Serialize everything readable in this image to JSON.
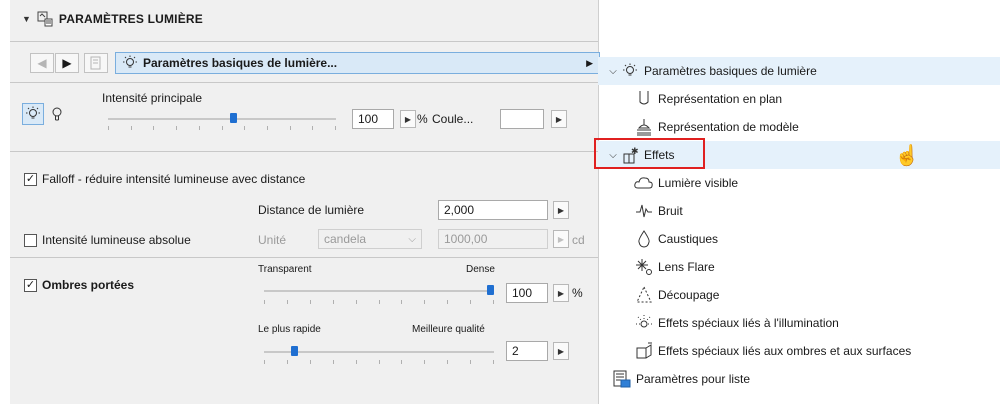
{
  "panel": {
    "title": "PARAMÈTRES LUMIÈRE",
    "preset": "Paramètres basiques de lumière...",
    "main_intensity_label": "Intensité principale",
    "main_intensity_value": "100",
    "main_intensity_level": 0.55,
    "percent_unit": "%",
    "color_label": "Coule...",
    "falloff": {
      "checked": true,
      "label": "Falloff - réduire intensité lumineuse avec distance"
    },
    "distance_label": "Distance de lumière",
    "distance_value": "2,000",
    "absolute": {
      "checked": false,
      "label": "Intensité lumineuse absolue"
    },
    "unit_label": "Unité",
    "unit_select": "candela",
    "absolute_value": "1000,00",
    "absolute_unit": "cd",
    "shadows": {
      "checked": true,
      "label": "Ombres portées"
    },
    "transparency_left": "Transparent",
    "transparency_right": "Dense",
    "transparency_value": "100",
    "transparency_level": 1.0,
    "quality_left": "Le plus rapide",
    "quality_right": "Meilleure qualité",
    "quality_value": "2",
    "quality_level": 0.12
  },
  "tree": {
    "items": [
      {
        "label": "Paramètres basiques de lumière",
        "icon": "light-bulb-icon",
        "expandable": true
      },
      {
        "label": "Représentation en plan",
        "icon": "plan-representation-icon"
      },
      {
        "label": "Représentation de modèle",
        "icon": "model-representation-icon"
      },
      {
        "label": "Effets",
        "icon": "effects-icon",
        "expandable": true
      },
      {
        "label": "Lumière visible",
        "icon": "cloud-icon"
      },
      {
        "label": "Bruit",
        "icon": "noise-icon"
      },
      {
        "label": "Caustiques",
        "icon": "drop-icon"
      },
      {
        "label": "Lens Flare",
        "icon": "lens-flare-icon"
      },
      {
        "label": "Découpage",
        "icon": "clipping-icon"
      },
      {
        "label": "Effets spéciaux liés à l'illumination",
        "icon": "illumination-effects-icon"
      },
      {
        "label": "Effets spéciaux liés aux ombres et aux surfaces",
        "icon": "shadow-surface-effects-icon"
      },
      {
        "label": "Paramètres pour liste",
        "icon": "list-settings-icon"
      }
    ]
  },
  "colors": {
    "accent": "#1f6fd1",
    "selection": "#e5f1fb",
    "highlight_box": "#e02020"
  }
}
